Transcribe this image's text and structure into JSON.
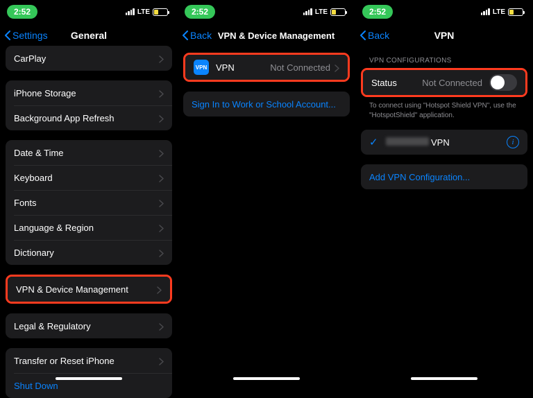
{
  "status": {
    "time": "2:52",
    "carrier": "LTE"
  },
  "screen1": {
    "back": "Settings",
    "title": "General",
    "group0": {
      "carplay": "CarPlay"
    },
    "group1": {
      "iphone_storage": "iPhone Storage",
      "background_refresh": "Background App Refresh"
    },
    "group2": {
      "date_time": "Date & Time",
      "keyboard": "Keyboard",
      "fonts": "Fonts",
      "language_region": "Language & Region",
      "dictionary": "Dictionary"
    },
    "group3": {
      "vpn_device": "VPN & Device Management"
    },
    "group4": {
      "legal": "Legal & Regulatory"
    },
    "group5": {
      "transfer_reset": "Transfer or Reset iPhone",
      "shutdown": "Shut Down"
    }
  },
  "screen2": {
    "back": "Back",
    "title": "VPN & Device Management",
    "vpn_label": "VPN",
    "vpn_status": "Not Connected",
    "vpn_badge": "VPN",
    "signin": "Sign In to Work or School Account..."
  },
  "screen3": {
    "back": "Back",
    "title": "VPN",
    "section_header": "VPN CONFIGURATIONS",
    "status_label": "Status",
    "status_value": "Not Connected",
    "footnote": "To connect using \"Hotspot Shield VPN\", use the \"HotspotShield\" application.",
    "config_suffix": "VPN",
    "add_config": "Add VPN Configuration..."
  }
}
